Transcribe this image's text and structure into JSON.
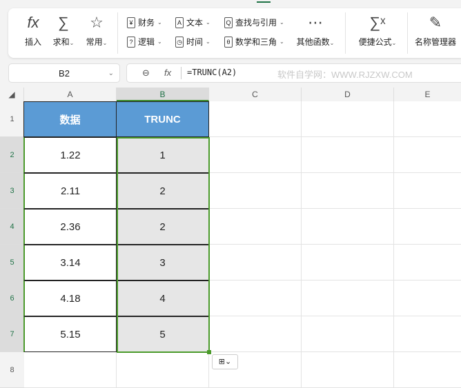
{
  "ribbon": {
    "insert": "插入",
    "sum": "求和",
    "common": "常用",
    "finance": "财务",
    "text": "文本",
    "lookup": "查找与引用",
    "logic": "逻辑",
    "time": "时间",
    "math": "数学和三角",
    "other": "其他函数",
    "quick": "便捷公式",
    "names": "名称管理器"
  },
  "formula_bar": {
    "name_box": "B2",
    "fx": "fx",
    "formula": "=TRUNC(A2)",
    "watermark": "软件自学网：WWW.RJZXW.COM"
  },
  "columns": [
    "A",
    "B",
    "C",
    "D",
    "E"
  ],
  "rows": [
    "1",
    "2",
    "3",
    "4",
    "5",
    "6",
    "7",
    "8"
  ],
  "table": {
    "headers": [
      "数据",
      "TRUNC"
    ],
    "rows": [
      [
        "1.22",
        "1"
      ],
      [
        "2.11",
        "2"
      ],
      [
        "2.36",
        "2"
      ],
      [
        "3.14",
        "3"
      ],
      [
        "4.18",
        "4"
      ],
      [
        "5.15",
        "5"
      ]
    ]
  },
  "colors": {
    "header": "#5b9bd5",
    "selection": "#4a9a2a"
  }
}
